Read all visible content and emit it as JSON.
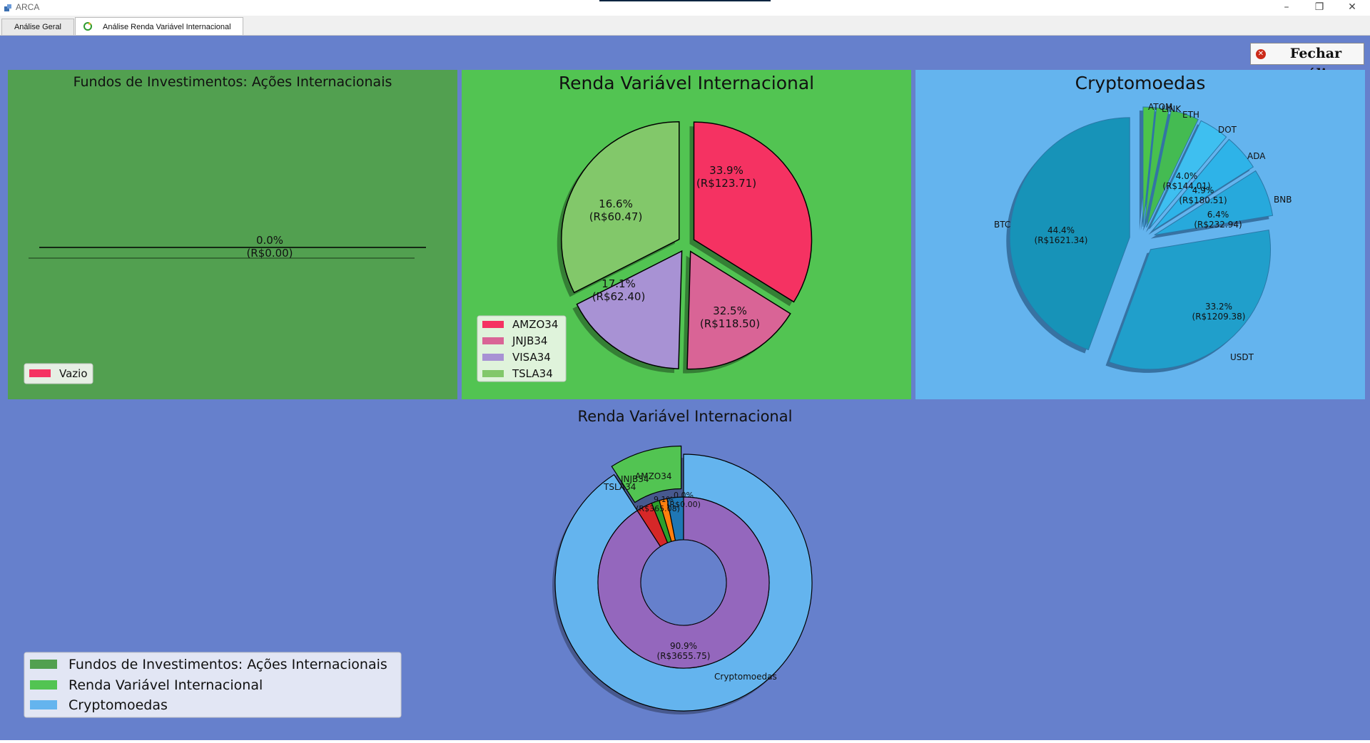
{
  "window": {
    "title": "ARCA"
  },
  "tabs": [
    {
      "label": "Análise Geral"
    },
    {
      "label": "Análise Renda Variável Internacional"
    }
  ],
  "close_button": {
    "label": "Fechar análise"
  },
  "colors": {
    "content_bg": "#6680cc",
    "panel_funds": "#52a050",
    "panel_renda": "#52c452",
    "panel_crypto": "#64b4ee"
  },
  "charts": {
    "funds": {
      "title": "Fundos de Investimentos: Ações Internacionais",
      "slice_label": [
        "0.0%",
        "(R$0.00)"
      ],
      "legend": [
        "Vazio"
      ]
    },
    "renda": {
      "title": "Renda Variável Internacional",
      "slices": [
        {
          "pct": "33.9%",
          "value": "(R$123.71)"
        },
        {
          "pct": "16.6%",
          "value": "(R$60.47)"
        },
        {
          "pct": "17.1%",
          "value": "(R$62.40)"
        },
        {
          "pct": "32.5%",
          "value": "(R$118.50)"
        }
      ],
      "legend": [
        "AMZO34",
        "JNJB34",
        "VISA34",
        "TSLA34"
      ]
    },
    "crypto": {
      "title": "Cryptomoedas",
      "names": [
        "BTC",
        "USDT",
        "BNB",
        "ADA",
        "DOT",
        "ETH",
        "LINK",
        "ATOM"
      ],
      "labels": [
        {
          "pct": "44.4%",
          "value": "(R$1621.34)"
        },
        {
          "pct": "33.2%",
          "value": "(R$1209.38)"
        },
        {
          "pct": "6.4%",
          "value": "(R$232.94)"
        },
        {
          "pct": "4.9%",
          "value": "(R$180.51)"
        },
        {
          "pct": "4.0%",
          "value": "(R$144.01)"
        }
      ]
    },
    "overall": {
      "title": "Renda Variável Internacional",
      "outer_labels": [
        "TSLA34",
        "JNJB34",
        "AMZO34",
        "Cryptomoedas"
      ],
      "inner_label": {
        "pct": "90.9%",
        "value": "(R$3655.75)"
      },
      "small_labels": [
        "0.0%",
        "(R$0.00)",
        "9.1%",
        "(R$365.08)"
      ],
      "legend": [
        "Fundos de Investimentos: Ações Internacionais",
        "Renda Variável Internacional",
        "Cryptomoedas"
      ]
    }
  },
  "chart_data": [
    {
      "type": "pie",
      "title": "Fundos de Investimentos: Ações Internacionais",
      "categories": [
        "Vazio"
      ],
      "values": [
        0.0
      ],
      "currency_values": [
        0.0
      ]
    },
    {
      "type": "pie",
      "title": "Renda Variável Internacional",
      "categories": [
        "AMZO34",
        "JNJB34",
        "VISA34",
        "TSLA34"
      ],
      "values": [
        33.9,
        16.6,
        17.1,
        32.5
      ],
      "currency_values": [
        123.71,
        60.47,
        62.4,
        118.5
      ],
      "colors": [
        "#f53262",
        "#d96496",
        "#a892d4",
        "#82c86a"
      ]
    },
    {
      "type": "pie",
      "title": "Cryptomoedas",
      "categories": [
        "BTC",
        "USDT",
        "BNB",
        "ADA",
        "DOT",
        "ETH",
        "LINK",
        "ATOM"
      ],
      "values": [
        44.4,
        33.2,
        6.4,
        4.9,
        4.0,
        3.8,
        1.7,
        1.6
      ],
      "currency_values": [
        1621.34,
        1209.38,
        232.94,
        180.51,
        144.01,
        138.41,
        null,
        null
      ],
      "colors": [
        "#1793b8",
        "#209fcb",
        "#27a9dc",
        "#2eb3e8",
        "#3ebff0",
        "#44bb52",
        "#48c04e",
        "#4cc44a"
      ]
    },
    {
      "type": "pie",
      "title": "Renda Variável Internacional",
      "rings": [
        {
          "name": "outer",
          "categories": [
            "Fundos de Investimentos: Ações Internacionais",
            "Renda Variável Internacional",
            "Cryptomoedas"
          ],
          "values": [
            0.0,
            9.1,
            90.9
          ],
          "currency_values": [
            0.0,
            365.08,
            3655.75
          ],
          "colors": [
            "#52a050",
            "#52c452",
            "#64b4ee"
          ]
        },
        {
          "name": "inner",
          "categories": [
            "TSLA34",
            "VISA34",
            "JNJB34",
            "AMZO34",
            "Cryptomoedas"
          ],
          "values": [
            3.0,
            1.5,
            1.5,
            3.1,
            90.9
          ],
          "colors": [
            "#d62728",
            "#2ca02c",
            "#ff7f0e",
            "#1f77b4",
            "#9467bd"
          ]
        }
      ],
      "legend_position": "lower-left"
    }
  ]
}
